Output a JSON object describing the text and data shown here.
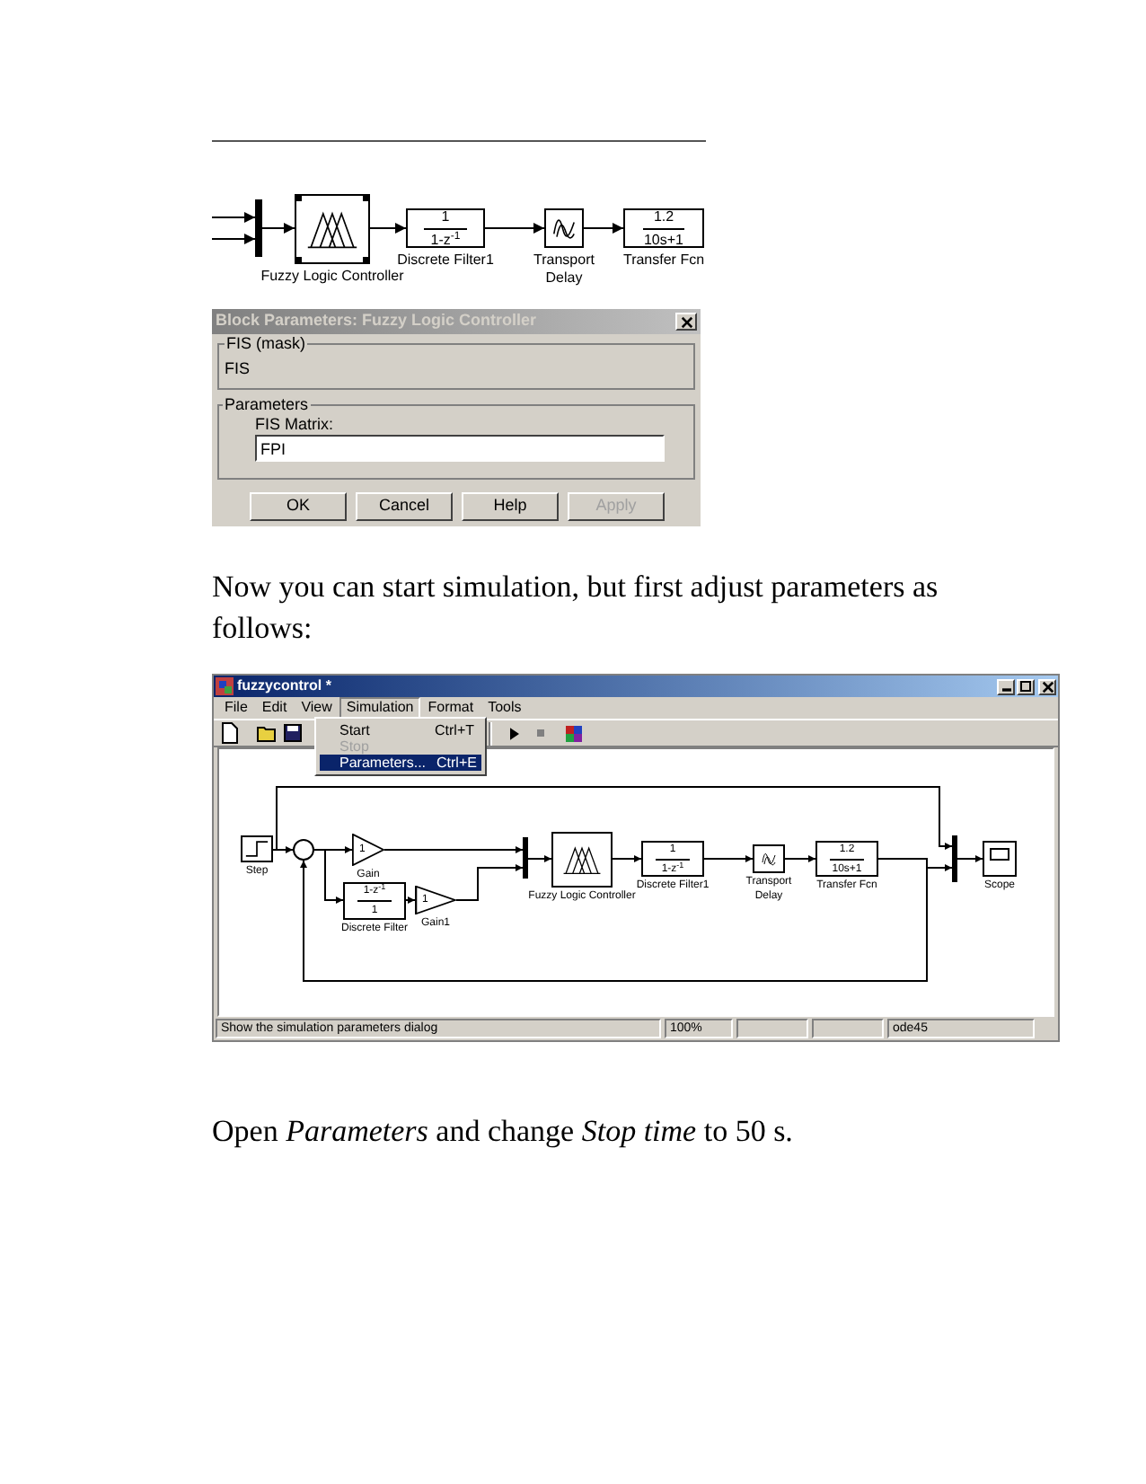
{
  "figure_1": {
    "diagram": {
      "blocks": [
        {
          "kind": "mux",
          "selected": false
        },
        {
          "kind": "fuzzy",
          "label": "Fuzzy Logic Controller",
          "selected": true
        },
        {
          "kind": "fraction",
          "numerator": "1",
          "denominator": "1-z$^{-1}$",
          "label": "Discrete Filter1",
          "selected": false
        },
        {
          "kind": "delay",
          "label": "Transport Delay",
          "selected": false
        },
        {
          "kind": "fraction",
          "numerator": "1.2",
          "denominator": "10s+1",
          "label": "Transfer Fcn",
          "selected": false
        }
      ]
    },
    "dialog": {
      "title": "Block Parameters: Fuzzy Logic Controller",
      "active": false,
      "mask_group": {
        "title": "FIS (mask)",
        "text": "FIS"
      },
      "parameters_group": {
        "title": "Parameters",
        "field_label": "FIS Matrix:",
        "value": "FPI"
      },
      "buttons": [
        {
          "label": "OK",
          "disabled": false
        },
        {
          "label": "Cancel",
          "disabled": false
        },
        {
          "label": "Help",
          "disabled": false
        },
        {
          "label": "Apply",
          "disabled": true
        }
      ]
    }
  },
  "paragraph_1": "Now you can start simulation, but first adjust parameters as follows:",
  "figure_2": {
    "window": {
      "title": "fuzzycontrol *",
      "active": true,
      "menu": [
        {
          "label": "File",
          "selected": false
        },
        {
          "label": "Edit",
          "selected": false
        },
        {
          "label": "View",
          "selected": false
        },
        {
          "label": "Simulation",
          "selected": true
        },
        {
          "label": "Format",
          "selected": false
        },
        {
          "label": "Tools",
          "selected": false
        }
      ],
      "dropdown": [
        {
          "label": "Start",
          "shortcut": "Ctrl+T",
          "disabled": false,
          "selected": false
        },
        {
          "label": "Stop",
          "disabled": true,
          "selected": false
        },
        {
          "label": "Parameters...",
          "shortcut": "Ctrl+E",
          "disabled": false,
          "selected": true
        }
      ],
      "diagram": {
        "blocks": [
          {
            "kind": "step",
            "label": "Step",
            "selected": false
          },
          {
            "kind": "sum",
            "selected": false
          },
          {
            "kind": "gain",
            "value": "1",
            "label": "Gain",
            "selected": false
          },
          {
            "kind": "fraction",
            "numerator": "1-z$^{-1}$",
            "denominator": "1",
            "label": "Discrete Filter",
            "selected": false
          },
          {
            "kind": "gain",
            "value": "1",
            "label": "Gain1",
            "selected": false
          },
          {
            "kind": "mux",
            "selected": false
          },
          {
            "kind": "fuzzy",
            "label": "Fuzzy Logic Controller",
            "selected": false
          },
          {
            "kind": "fraction",
            "numerator": "1",
            "denominator": "1-z$^{-1}$",
            "label": "Discrete Filter1",
            "selected": false
          },
          {
            "kind": "delay",
            "label": "Transport Delay",
            "selected": false
          },
          {
            "kind": "fraction",
            "numerator": "1.2",
            "denominator": "10s+1",
            "label": "Transfer Fcn",
            "selected": false
          },
          {
            "kind": "mux",
            "selected": false
          },
          {
            "kind": "scope",
            "label": "Scope",
            "selected": false
          }
        ]
      },
      "status_bar": {
        "message": "Show the simulation parameters dialog",
        "zoom": "100%",
        "solver": "ode45"
      }
    }
  },
  "paragraph_2": "Open *Parameters* and change *Stop time* to 50 s."
}
